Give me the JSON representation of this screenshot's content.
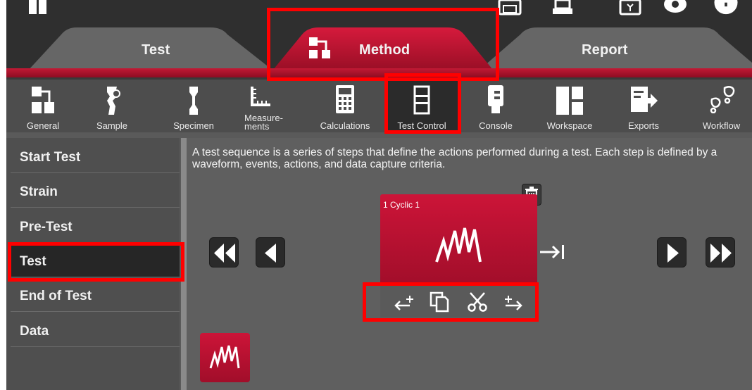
{
  "tabs": {
    "test": "Test",
    "method": "Method",
    "report": "Report"
  },
  "toolbar": {
    "items": [
      {
        "label": "General",
        "icon": "general-icon"
      },
      {
        "label": "Sample",
        "icon": "sample-icon"
      },
      {
        "label": "Specimen",
        "icon": "specimen-icon"
      },
      {
        "label": "Measure-\nments",
        "icon": "measurements-icon"
      },
      {
        "label": "Calculations",
        "icon": "calculator-icon"
      },
      {
        "label": "Test Control",
        "icon": "test-control-icon"
      },
      {
        "label": "Console",
        "icon": "console-icon"
      },
      {
        "label": "Workspace",
        "icon": "workspace-icon"
      },
      {
        "label": "Exports",
        "icon": "exports-icon"
      },
      {
        "label": "Workflow",
        "icon": "workflow-icon"
      }
    ],
    "active": "Test Control"
  },
  "sidebar": {
    "items": [
      {
        "label": "Start Test"
      },
      {
        "label": "Strain"
      },
      {
        "label": "Pre-Test"
      },
      {
        "label": "Test"
      },
      {
        "label": "End of Test"
      },
      {
        "label": "Data"
      }
    ],
    "active": "Test"
  },
  "main": {
    "description": "A test sequence is a series of steps that define the actions performed during a test.  Each step is defined by a waveform, events, actions, and data capture criteria.",
    "step": {
      "label": "1 Cyclic 1",
      "icon": "cyclic-waveform-icon"
    },
    "step_actions": [
      "insert-before-icon",
      "copy-icon",
      "cut-icon",
      "insert-after-icon"
    ]
  },
  "colors": {
    "accent_red": "#c8102e",
    "highlight": "#ff0000",
    "dark_bg": "#2f2f2f"
  }
}
